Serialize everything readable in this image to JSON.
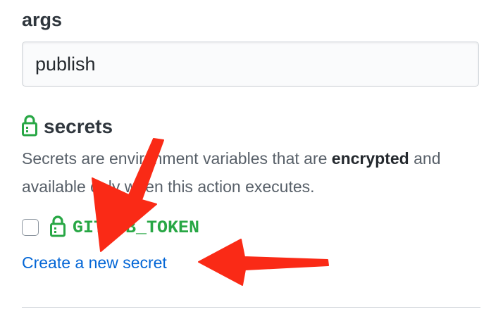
{
  "args": {
    "label": "args",
    "value": "publish"
  },
  "secrets": {
    "title": "secrets",
    "description_part1": "Secrets are environment variables that are ",
    "description_bold": "encrypted",
    "description_part2": " and available only when this action executes.",
    "items": [
      {
        "name": "GITHUB_TOKEN",
        "checked": false
      }
    ],
    "create_link": "Create a new secret"
  },
  "annotations": {
    "arrow_color": "#fa2a16"
  },
  "colors": {
    "secret_green": "#28a745",
    "link_blue": "#0366d6"
  },
  "icons": {
    "lock": "lock-icon"
  }
}
